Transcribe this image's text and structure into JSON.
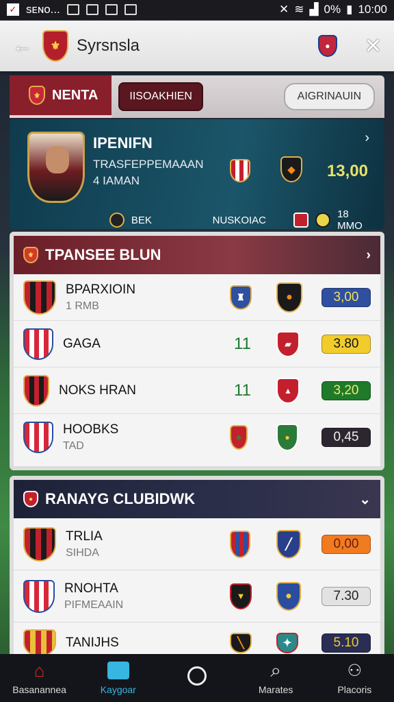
{
  "status": {
    "left": "sᴇɴᴏ...",
    "battery": "0%",
    "time": "10:00"
  },
  "appbar": {
    "title": "Syrsnsla"
  },
  "tabs": {
    "active": "NENTA",
    "pill1": "IISOAKHIEN",
    "pill2": "AIGRINAUIN"
  },
  "hero": {
    "name": "IPENIFN",
    "sub": "TRASFEPPEMAAAN",
    "sub2": "4 IAMAN",
    "value": "13,00",
    "foot": [
      "BEK",
      "NUSKOIAC",
      "18 MMO"
    ]
  },
  "panel1": {
    "title": "TPANSEE BLUN",
    "rows": [
      {
        "t1": "BPARXIOIN",
        "t2": "1 RMB",
        "num": "",
        "odds": "3,00",
        "odds_color": "#2f4fa0",
        "odds_text": "#f1e35c"
      },
      {
        "t1": "GAGA",
        "t2": "",
        "num": "11",
        "odds": "3.80",
        "odds_color": "#f1cc2b",
        "odds_text": "#111"
      },
      {
        "t1": "NOKS HRAN",
        "t2": "",
        "num": "11",
        "odds": "3,20",
        "odds_color": "#1f7a2a",
        "odds_text": "#f6e76a"
      },
      {
        "t1": "HOOBKS",
        "t2": "TAD",
        "num": "",
        "odds": "0,45",
        "odds_color": "#2c2630",
        "odds_text": "#eee"
      }
    ]
  },
  "panel2": {
    "title": "RANAYG CLUBIDWK",
    "rows": [
      {
        "t1": "TRLIA",
        "t2": "SIHDA",
        "odds": "0,00",
        "odds_color": "#f07b20",
        "odds_text": "#6b1a10"
      },
      {
        "t1": "RNOHTA",
        "t2": "PIFMEAAIN",
        "odds": "7.30",
        "odds_color": "#e2e2e2",
        "odds_text": "#222"
      },
      {
        "t1": "TANIJHS",
        "t2": "",
        "odds": "5.10",
        "odds_color": "#2a2e55",
        "odds_text": "#f1cc2b"
      }
    ]
  },
  "nav": [
    "Basanannea",
    "Kaygoar",
    "",
    "Marates",
    "Placoris"
  ],
  "colors": {
    "accent": "#8a1f2c",
    "hero": "#1b5569",
    "nav_active": "#36b6e0"
  }
}
